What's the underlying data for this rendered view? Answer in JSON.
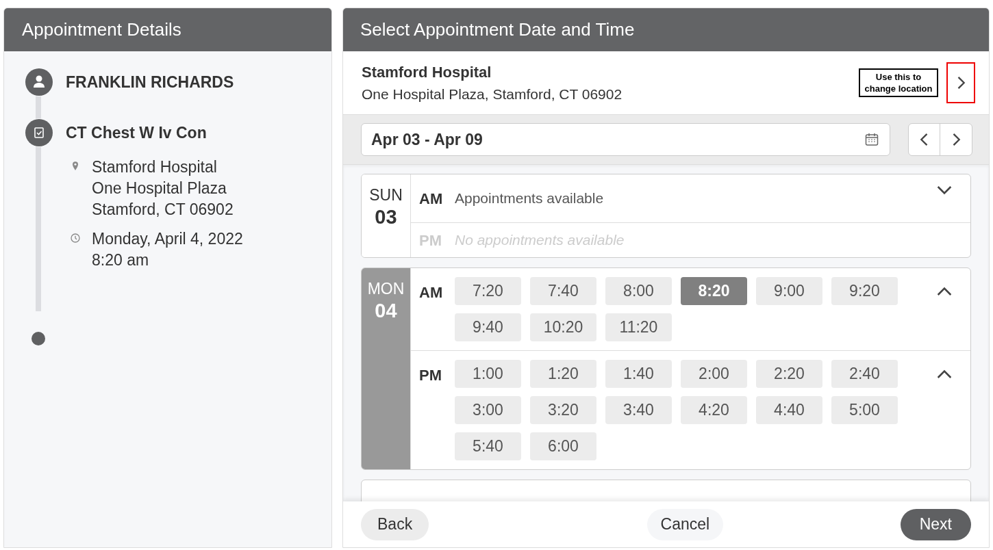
{
  "details_panel": {
    "title": "Appointment Details",
    "steps": [
      {
        "kind": "person",
        "title": "FRANKLIN RICHARDS"
      },
      {
        "kind": "procedure",
        "title": "CT Chest W Iv Con",
        "details": [
          {
            "kind": "location",
            "lines": [
              "Stamford Hospital",
              "One Hospital Plaza",
              "Stamford, CT 06902"
            ]
          },
          {
            "kind": "time",
            "lines": [
              "Monday, April 4, 2022",
              "8:20 am"
            ]
          }
        ]
      }
    ]
  },
  "schedule_panel": {
    "title": "Select Appointment Date and Time",
    "location": {
      "name": "Stamford Hospital",
      "address": "One Hospital Plaza, Stamford, CT 06902",
      "annotation": "Use this to change location",
      "highlighted": true
    },
    "date_range": "Apr 03 - Apr 09",
    "days": [
      {
        "weekday": "SUN",
        "date": "03",
        "selected": false,
        "periods": [
          {
            "label": "AM",
            "available": true,
            "expanded": false,
            "summary": "Appointments available"
          },
          {
            "label": "PM",
            "available": false,
            "summary": "No appointments available"
          }
        ]
      },
      {
        "weekday": "MON",
        "date": "04",
        "selected": true,
        "periods": [
          {
            "label": "AM",
            "available": true,
            "expanded": true,
            "slots": [
              {
                "time": "7:20",
                "selected": false
              },
              {
                "time": "7:40",
                "selected": false
              },
              {
                "time": "8:00",
                "selected": false
              },
              {
                "time": "8:20",
                "selected": true
              },
              {
                "time": "9:00",
                "selected": false
              },
              {
                "time": "9:20",
                "selected": false
              },
              {
                "time": "9:40",
                "selected": false
              },
              {
                "time": "10:20",
                "selected": false
              },
              {
                "time": "11:20",
                "selected": false
              }
            ]
          },
          {
            "label": "PM",
            "available": true,
            "expanded": true,
            "slots": [
              {
                "time": "1:00",
                "selected": false
              },
              {
                "time": "1:20",
                "selected": false
              },
              {
                "time": "1:40",
                "selected": false
              },
              {
                "time": "2:00",
                "selected": false
              },
              {
                "time": "2:20",
                "selected": false
              },
              {
                "time": "2:40",
                "selected": false
              },
              {
                "time": "3:00",
                "selected": false
              },
              {
                "time": "3:20",
                "selected": false
              },
              {
                "time": "3:40",
                "selected": false
              },
              {
                "time": "4:20",
                "selected": false
              },
              {
                "time": "4:40",
                "selected": false
              },
              {
                "time": "5:00",
                "selected": false
              },
              {
                "time": "5:40",
                "selected": false
              },
              {
                "time": "6:00",
                "selected": false
              }
            ]
          }
        ]
      }
    ],
    "footer": {
      "back": "Back",
      "cancel": "Cancel",
      "next": "Next"
    }
  }
}
